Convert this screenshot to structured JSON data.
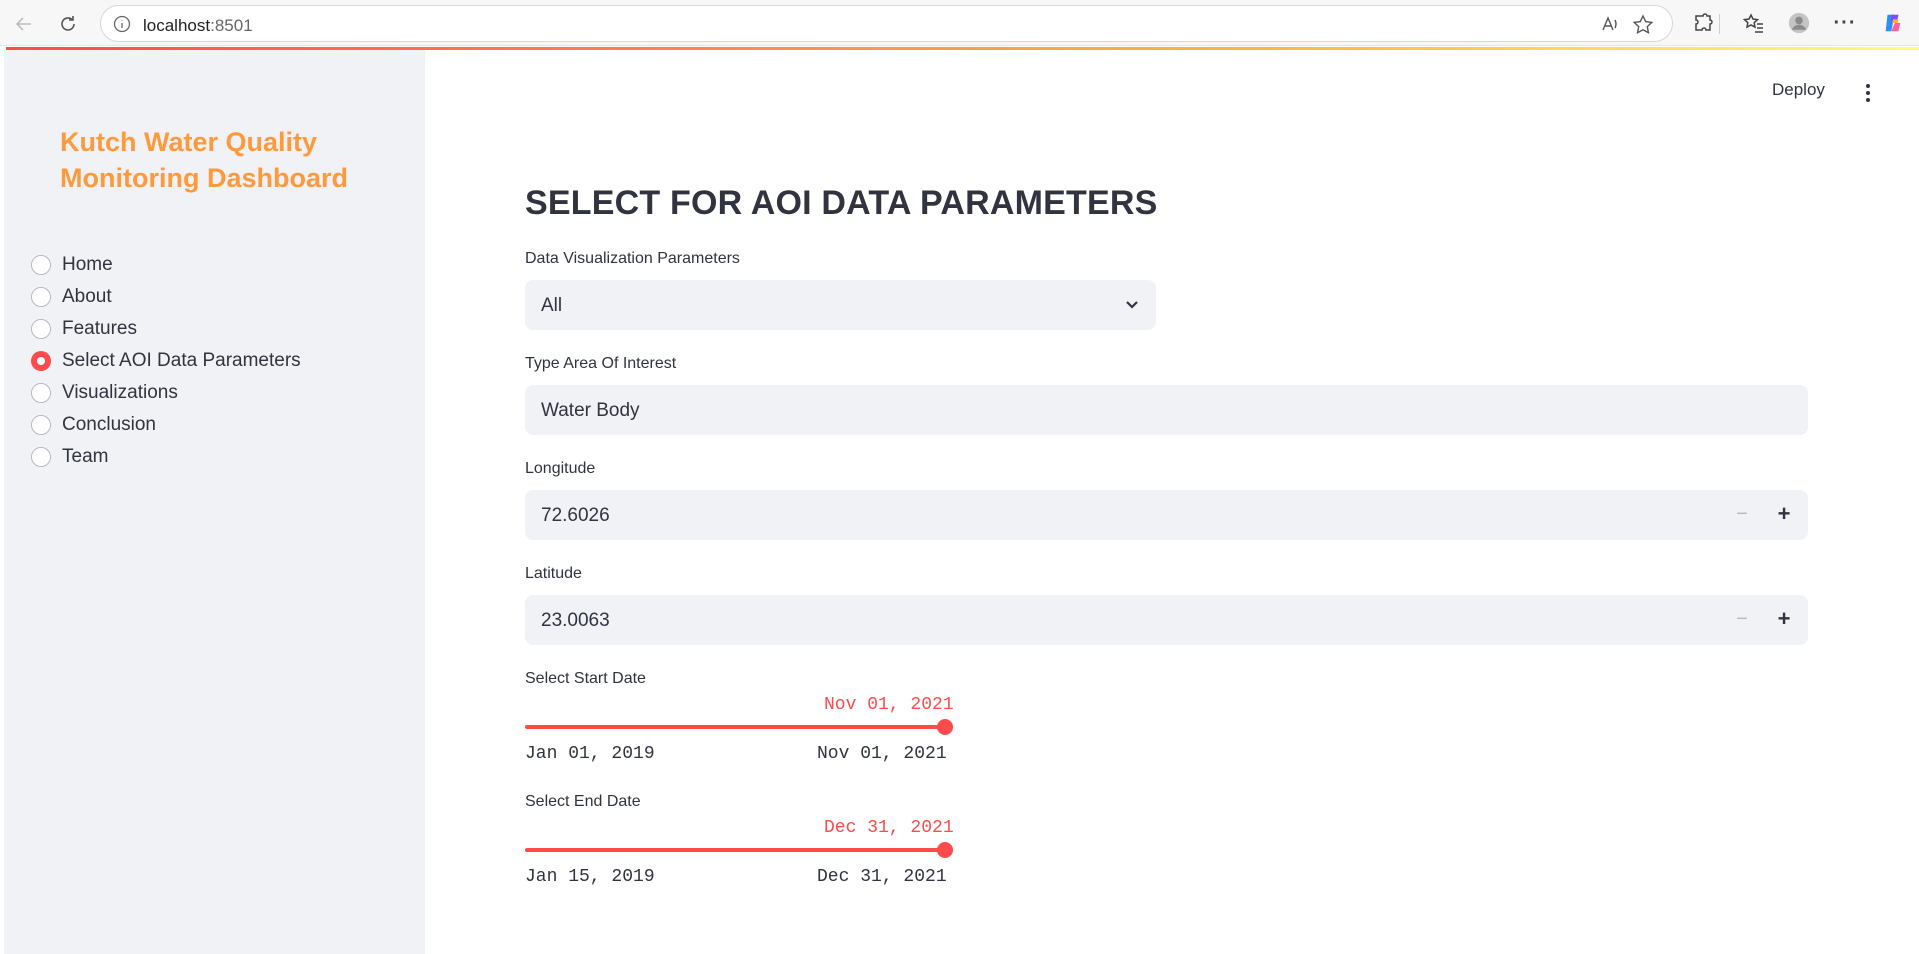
{
  "browser": {
    "url_host": "localhost",
    "url_port": ":8501",
    "more_label": "···"
  },
  "sidebar": {
    "title": "Kutch Water Quality Monitoring Dashboard",
    "nav_items": [
      {
        "label": "Home",
        "selected": false
      },
      {
        "label": "About",
        "selected": false
      },
      {
        "label": "Features",
        "selected": false
      },
      {
        "label": "Select AOI Data Parameters",
        "selected": true
      },
      {
        "label": "Visualizations",
        "selected": false
      },
      {
        "label": "Conclusion",
        "selected": false
      },
      {
        "label": "Team",
        "selected": false
      }
    ]
  },
  "header": {
    "deploy_label": "Deploy"
  },
  "main": {
    "title": "SELECT FOR AOI DATA PARAMETERS",
    "viz_param": {
      "label": "Data Visualization Parameters",
      "value": "All"
    },
    "aoi": {
      "label": "Type Area Of Interest",
      "value": "Water Body"
    },
    "longitude": {
      "label": "Longitude",
      "value": "72.6026",
      "minus": "−",
      "plus": "+"
    },
    "latitude": {
      "label": "Latitude",
      "value": "23.0063",
      "minus": "−",
      "plus": "+"
    },
    "start_date": {
      "label": "Select Start Date",
      "current": "Nov 01, 2021",
      "min": "Jan 01, 2019",
      "max": "Nov 01, 2021",
      "fraction": 1.0
    },
    "end_date": {
      "label": "Select End Date",
      "current": "Dec 31, 2021",
      "min": "Jan 15, 2019",
      "max": "Dec 31, 2021",
      "fraction": 1.0
    }
  },
  "colors": {
    "accent": "#ff4b4b",
    "title_orange": "#ff9a3c",
    "sidebar_bg": "#f0f2f6"
  }
}
